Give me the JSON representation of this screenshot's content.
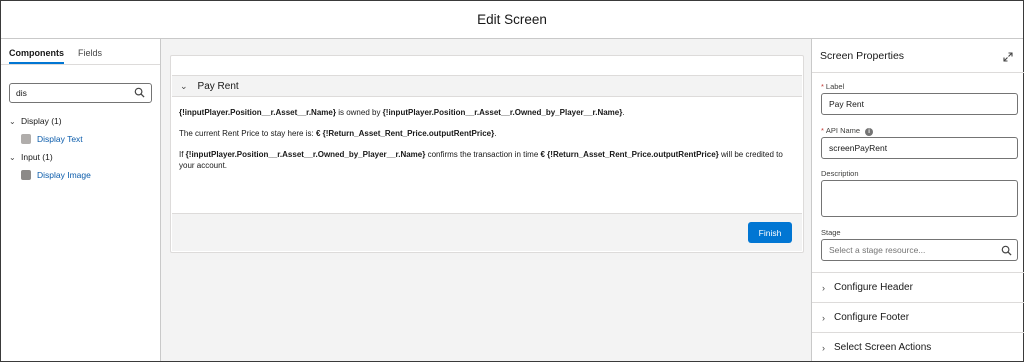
{
  "header": {
    "title": "Edit Screen"
  },
  "left_panel": {
    "tabs": [
      {
        "label": "Components",
        "active": true
      },
      {
        "label": "Fields",
        "active": false
      }
    ],
    "search": {
      "value": "dis"
    },
    "groups": [
      {
        "label": "Display (1)",
        "items": [
          {
            "label": "Display Text"
          }
        ]
      },
      {
        "label": "Input (1)",
        "items": [
          {
            "label": "Display Image"
          }
        ]
      }
    ]
  },
  "canvas": {
    "section": {
      "title": "Pay Rent"
    },
    "line1": {
      "a": "{!inputPlayer.Position__r.Asset__r.Name}",
      "b": " is owned by ",
      "c": "{!inputPlayer.Position__r.Asset__r.Owned_by_Player__r.Name}",
      "d": "."
    },
    "line2": {
      "a": "The current Rent Price to stay here is: ",
      "b": "€ {!Return_Asset_Rent_Price.outputRentPrice}",
      "c": "."
    },
    "line3": {
      "a": "If ",
      "b": "{!inputPlayer.Position__r.Asset__r.Owned_by_Player__r.Name}",
      "c": " confirms the transaction in time ",
      "d": "€ {!Return_Asset_Rent_Price.outputRentPrice}",
      "e": " will be credited to your account."
    },
    "finish_label": "Finish"
  },
  "right_panel": {
    "title": "Screen Properties",
    "label_field": {
      "label": "Label",
      "value": "Pay Rent"
    },
    "api_name_field": {
      "label": "API Name",
      "value": "screenPayRent"
    },
    "description_field": {
      "label": "Description",
      "value": ""
    },
    "stage_field": {
      "label": "Stage",
      "placeholder": "Select a stage resource..."
    },
    "sections": [
      {
        "label": "Configure Header"
      },
      {
        "label": "Configure Footer"
      },
      {
        "label": "Select Screen Actions"
      }
    ]
  },
  "colors": {
    "brand": "#0176d3",
    "link": "#0b5cab",
    "required": "#c23934"
  }
}
